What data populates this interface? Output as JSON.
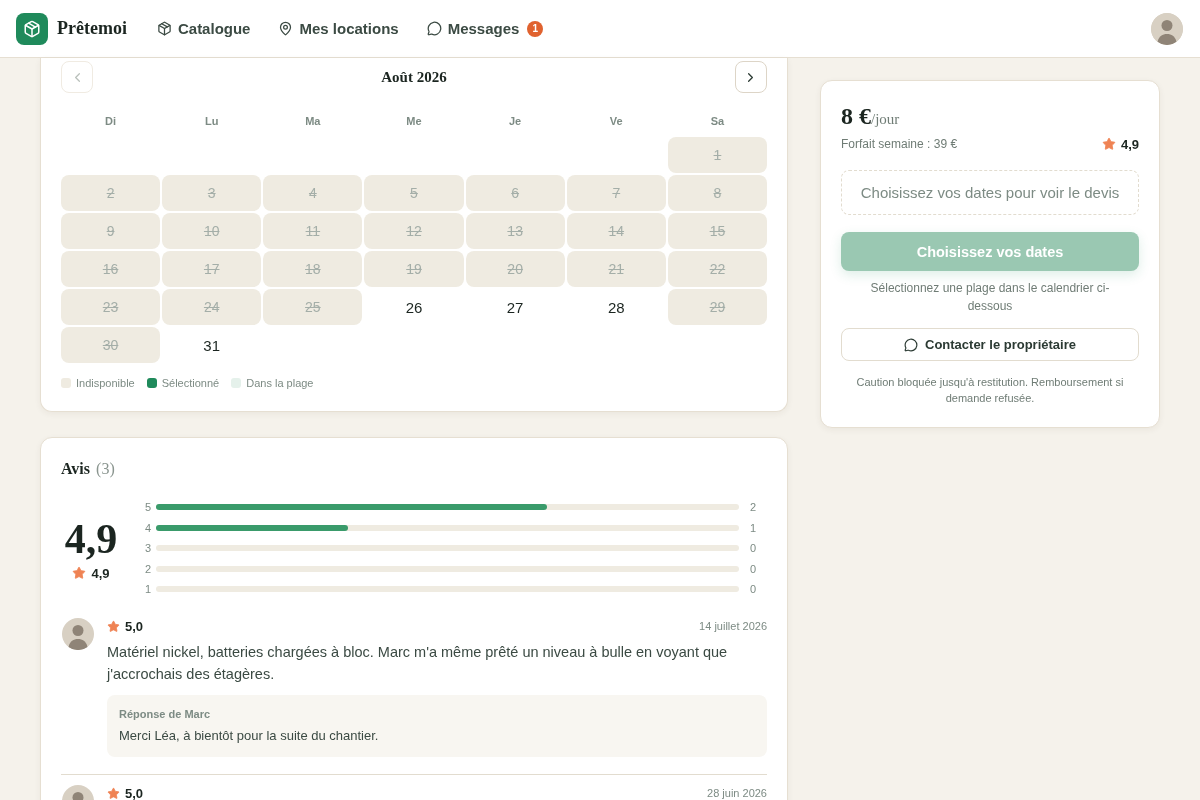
{
  "header": {
    "brand": "Prêtemoi",
    "nav": [
      {
        "label": "Catalogue"
      },
      {
        "label": "Mes locations"
      },
      {
        "label": "Messages",
        "badge": "1"
      }
    ]
  },
  "calendar": {
    "month": "Août 2026",
    "previous_button": {
      "disabled": true
    },
    "next_button": {
      "disabled": false
    },
    "weekdays": [
      "Di",
      "Lu",
      "Ma",
      "Me",
      "Je",
      "Ve",
      "Sa"
    ],
    "weeks": [
      [
        {
          "day": "1",
          "unavailable": true
        }
      ],
      [
        {
          "day": "2",
          "unavailable": true
        },
        {
          "day": "3",
          "unavailable": true
        },
        {
          "day": "4",
          "unavailable": true
        },
        {
          "day": "5",
          "unavailable": true
        },
        {
          "day": "6",
          "unavailable": true
        },
        {
          "day": "7",
          "unavailable": true
        },
        {
          "day": "8",
          "unavailable": true
        }
      ],
      [
        {
          "day": "9",
          "unavailable": true
        },
        {
          "day": "10",
          "unavailable": true
        },
        {
          "day": "11",
          "unavailable": true
        },
        {
          "day": "12",
          "unavailable": true
        },
        {
          "day": "13",
          "unavailable": true
        },
        {
          "day": "14",
          "unavailable": true
        },
        {
          "day": "15",
          "unavailable": true
        }
      ],
      [
        {
          "day": "16",
          "unavailable": true
        },
        {
          "day": "17",
          "unavailable": true
        },
        {
          "day": "18",
          "unavailable": true
        },
        {
          "day": "19",
          "unavailable": true
        },
        {
          "day": "20",
          "unavailable": true
        },
        {
          "day": "21",
          "unavailable": true
        },
        {
          "day": "22",
          "unavailable": true
        }
      ],
      [
        {
          "day": "23",
          "unavailable": true
        },
        {
          "day": "24",
          "unavailable": true
        },
        {
          "day": "25",
          "unavailable": true
        },
        {
          "day": "26",
          "unavailable": false
        },
        {
          "day": "27",
          "unavailable": false
        },
        {
          "day": "28",
          "unavailable": false
        },
        {
          "day": "29",
          "unavailable": true
        }
      ],
      [
        {
          "day": "30",
          "unavailable": true
        },
        {
          "day": "31",
          "unavailable": false
        }
      ]
    ],
    "legend": [
      {
        "label": "Indisponible",
        "color": "#efebe1"
      },
      {
        "label": "Sélectionné",
        "color": "#1f8a5b"
      },
      {
        "label": "Dans la plage",
        "color": "#e5f1eb"
      }
    ]
  },
  "reviews": {
    "title": "Avis",
    "count": "(3)",
    "average": "4,9",
    "average_small": "4,9",
    "distribution": [
      {
        "label": "5",
        "level": 0.67,
        "count": "2"
      },
      {
        "label": "4",
        "level": 0.33,
        "count": "1"
      },
      {
        "label": "3",
        "count": "0"
      },
      {
        "label": "2",
        "count": "0"
      },
      {
        "label": "1",
        "count": "0"
      }
    ],
    "items": [
      {
        "rating": "5,0",
        "date": "14 juillet 2026",
        "text": "Matériel nickel, batteries chargées à bloc. Marc m'a même prêté un niveau à bulle en voyant que j'accrochais des étagères.",
        "reply": {
          "label": "Réponse de Marc",
          "text": "Merci Léa, à bientôt pour la suite du chantier."
        }
      },
      {
        "rating": "5,0",
        "date": "28 juin 2026"
      }
    ]
  },
  "booking": {
    "price": "8 €",
    "unit": "/jour",
    "weekly": "Forfait semaine : 39 €",
    "rating": "4,9",
    "quote_text": "Choisissez vos dates pour voir le devis",
    "primary_button": {
      "label": "Choisissez vos dates",
      "disabled": true
    },
    "hint": "Sélectionnez une plage dans le calendrier ci-dessous",
    "contact_button": "Contacter le propriétaire",
    "note": "Caution bloquée jusqu'à restitution. Remboursement si demande refusée."
  }
}
